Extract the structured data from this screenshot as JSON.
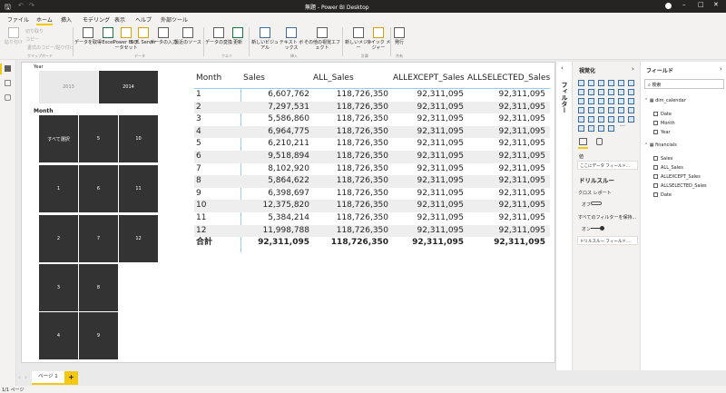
{
  "title": "無題 - Power BI Desktop",
  "tabs": [
    "ファイル",
    "ホーム",
    "挿入",
    "モデリング",
    "表示",
    "ヘルプ",
    "外部ツール"
  ],
  "ribbon": {
    "clipboard": {
      "paste": "貼り付け",
      "cut": "切り取り",
      "copy": "コピー",
      "format": "書式のコピー/貼り付け",
      "group": "クリップボード"
    },
    "data": {
      "items": [
        "データを取得",
        "Excel",
        "Power BI データセット",
        "SQL Server",
        "データの入力",
        "最近のソース"
      ],
      "group": "データ"
    },
    "query": {
      "items": [
        "データの変換",
        "更新"
      ],
      "group": "クエリ"
    },
    "insert": {
      "items": [
        "新しいビジュアル",
        "テキスト ボックス",
        "その他の視覚エフェクト"
      ],
      "group": "挿入"
    },
    "calc": {
      "items": [
        "新しいメジャー",
        "クイック メジャー"
      ],
      "group": "計算"
    },
    "share": {
      "items": [
        "発行"
      ],
      "group": "共有"
    }
  },
  "slicer_year": {
    "title": "Year",
    "items": [
      "2013",
      "2014"
    ]
  },
  "slicer_month": {
    "title": "Month",
    "items": [
      "すべて選択",
      "1",
      "2",
      "3",
      "4",
      "5",
      "6",
      "7",
      "8",
      "9",
      "10",
      "11",
      "12"
    ]
  },
  "table": {
    "headers": [
      "Month",
      "Sales",
      "ALL_Sales",
      "ALLEXCEPT_Sales",
      "ALLSELECTED_Sales"
    ],
    "rows": [
      [
        "1",
        "6,607,762",
        "118,726,350",
        "92,311,095",
        "92,311,095"
      ],
      [
        "2",
        "7,297,531",
        "118,726,350",
        "92,311,095",
        "92,311,095"
      ],
      [
        "3",
        "5,586,860",
        "118,726,350",
        "92,311,095",
        "92,311,095"
      ],
      [
        "4",
        "6,964,775",
        "118,726,350",
        "92,311,095",
        "92,311,095"
      ],
      [
        "5",
        "6,210,211",
        "118,726,350",
        "92,311,095",
        "92,311,095"
      ],
      [
        "6",
        "9,518,894",
        "118,726,350",
        "92,311,095",
        "92,311,095"
      ],
      [
        "7",
        "8,102,920",
        "118,726,350",
        "92,311,095",
        "92,311,095"
      ],
      [
        "8",
        "5,864,622",
        "118,726,350",
        "92,311,095",
        "92,311,095"
      ],
      [
        "9",
        "6,398,697",
        "118,726,350",
        "92,311,095",
        "92,311,095"
      ],
      [
        "10",
        "12,375,820",
        "118,726,350",
        "92,311,095",
        "92,311,095"
      ],
      [
        "11",
        "5,384,214",
        "118,726,350",
        "92,311,095",
        "92,311,095"
      ],
      [
        "12",
        "11,998,788",
        "118,726,350",
        "92,311,095",
        "92,311,095"
      ]
    ],
    "total": [
      "合計",
      "92,311,095",
      "118,726,350",
      "92,311,095",
      "92,311,095"
    ]
  },
  "filters": {
    "label": "フィルター"
  },
  "viz": {
    "title": "視覚化",
    "values_label": "値",
    "values_placeholder": "ここにデータ フィールド...",
    "drill": "ドリルスルー",
    "cross_report": "クロス レポート",
    "cross_state": "オフ",
    "keep_filters": "すべてのフィルターを保持...",
    "keep_state": "オン",
    "drill_placeholder": "ドリルスルー フィールド..."
  },
  "fields": {
    "title": "フィールド",
    "search_placeholder": "検索",
    "tables": [
      {
        "name": "dim_calendar",
        "fields": [
          "Date",
          "Month",
          "Year"
        ]
      },
      {
        "name": "financials",
        "fields": [
          "Sales",
          "ALL_Sales",
          "ALLEXCEPT_Sales",
          "ALLSELECTED_Sales",
          "Date"
        ]
      }
    ]
  },
  "pages": {
    "tab": "ページ 1",
    "add": "+"
  },
  "status": "1/1 ページ",
  "colors": {
    "accent": "#f2c811",
    "dark": "#252423",
    "slicer": "#333333"
  }
}
